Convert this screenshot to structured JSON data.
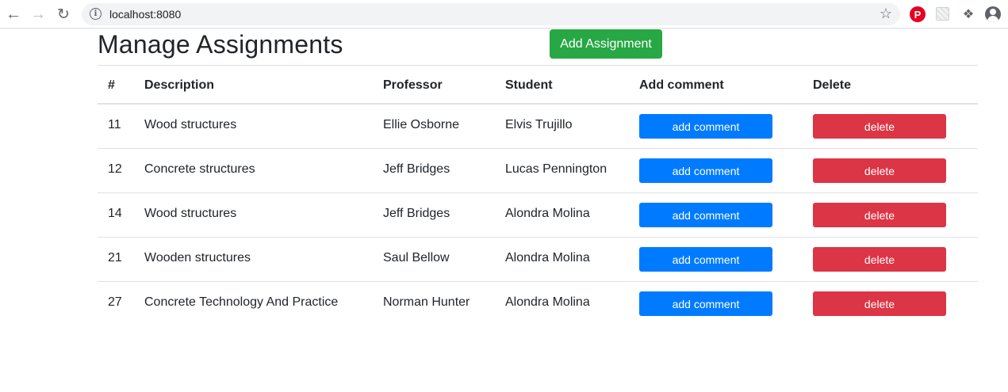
{
  "browser": {
    "url": "localhost:8080"
  },
  "page": {
    "title": "Manage Assignments",
    "add_button_label": "Add Assignment"
  },
  "table": {
    "headers": [
      "#",
      "Description",
      "Professor",
      "Student",
      "Add comment",
      "Delete"
    ],
    "rows": [
      {
        "id": "11",
        "description": "Wood structures",
        "professor": "Ellie Osborne",
        "student": "Elvis Trujillo",
        "comment_label": "add comment",
        "delete_label": "delete"
      },
      {
        "id": "12",
        "description": "Concrete structures",
        "professor": "Jeff Bridges",
        "student": "Lucas Pennington",
        "comment_label": "add comment",
        "delete_label": "delete"
      },
      {
        "id": "14",
        "description": "Wood structures",
        "professor": "Jeff Bridges",
        "student": "Alondra Molina",
        "comment_label": "add comment",
        "delete_label": "delete"
      },
      {
        "id": "21",
        "description": "Wooden structures",
        "professor": "Saul Bellow",
        "student": "Alondra Molina",
        "comment_label": "add comment",
        "delete_label": "delete"
      },
      {
        "id": "27",
        "description": "Concrete Technology And Practice",
        "professor": "Norman Hunter",
        "student": "Alondra Molina",
        "comment_label": "add comment",
        "delete_label": "delete"
      }
    ]
  },
  "colors": {
    "success": "#28a745",
    "primary": "#007bff",
    "danger": "#dc3545"
  }
}
